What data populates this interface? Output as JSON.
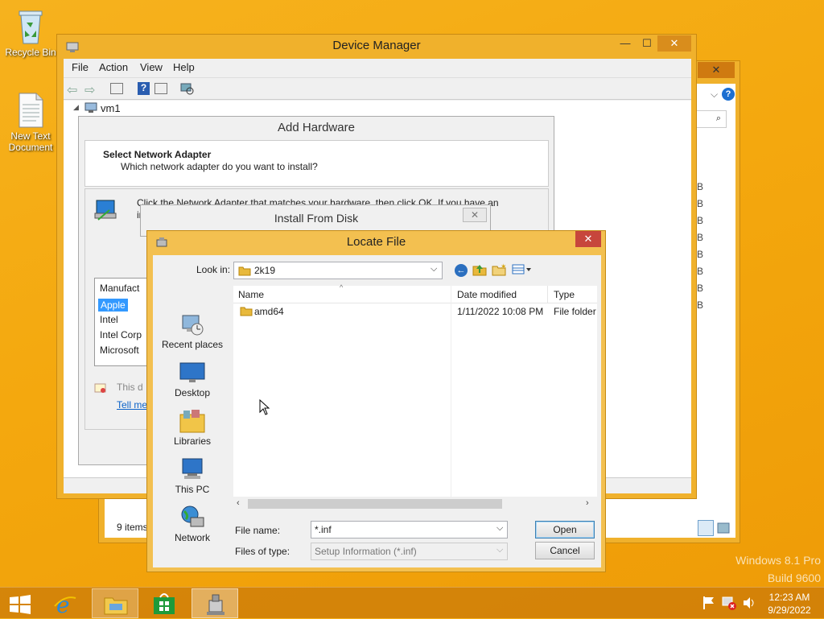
{
  "desktop": {
    "icons": [
      {
        "label": "Recycle Bin"
      },
      {
        "label": "New Text Document"
      }
    ],
    "watermark": {
      "line1": "Windows 8.1 Pro",
      "line2": "Build 9600"
    }
  },
  "device_manager": {
    "title": "Device Manager",
    "menu": [
      "File",
      "Action",
      "View",
      "Help"
    ],
    "tree_root": "vm1"
  },
  "explorer_bg": {
    "status": "9 items",
    "size_suffix": "B"
  },
  "add_hardware": {
    "title": "Add Hardware",
    "header_title": "Select Network Adapter",
    "header_sub": "Which network adapter do you want to install?",
    "instruction": "Click the Network Adapter that matches your hardware, then click OK. If you have an",
    "instruction_cut": "in",
    "manufacturer_header": "Manufact",
    "manufacturers": [
      "Apple",
      "Intel",
      "Intel Corp",
      "Microsoft"
    ],
    "signed_note": "This d",
    "tell_me": "Tell me"
  },
  "install_from_disk": {
    "title": "Install From Disk"
  },
  "locate_file": {
    "title": "Locate File",
    "look_in_label": "Look in:",
    "look_in_value": "2k19",
    "places": [
      "Recent places",
      "Desktop",
      "Libraries",
      "This PC",
      "Network"
    ],
    "columns": [
      "Name",
      "Date modified",
      "Type"
    ],
    "rows": [
      {
        "name": "amd64",
        "date": "1/11/2022 10:08 PM",
        "type": "File folder"
      }
    ],
    "file_name_label": "File name:",
    "file_name_value": "*.inf",
    "file_type_label": "Files of type:",
    "file_type_value": "Setup Information (*.inf)",
    "open_label": "Open",
    "cancel_label": "Cancel"
  },
  "taskbar": {
    "time": "12:23 AM",
    "date": "9/29/2022"
  },
  "colors": {
    "accent_close": "#c7463c",
    "selection": "#3399ff",
    "desktop": "#f4a80e"
  }
}
